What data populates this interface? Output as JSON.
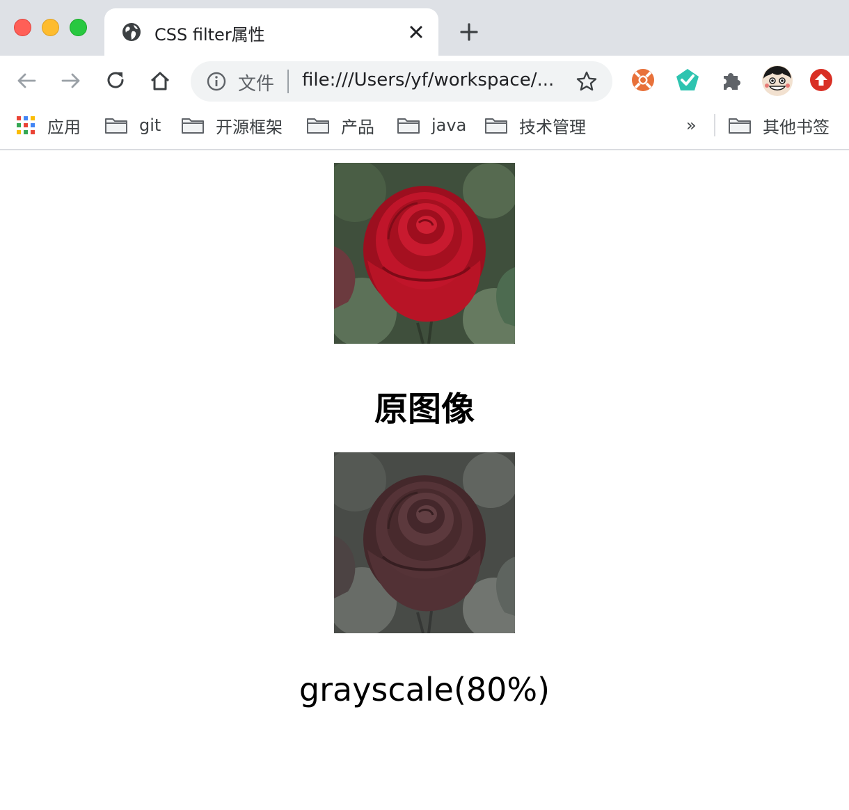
{
  "tab": {
    "title": "CSS filter属性",
    "close_icon": "close-icon",
    "favicon": "globe-icon"
  },
  "new_tab_icon": "plus-icon",
  "window_controls": {
    "close": "#ff5f57",
    "minimize": "#febc2e",
    "maximize": "#28c840"
  },
  "toolbar": {
    "back_icon": "arrow-left-icon",
    "forward_icon": "arrow-right-icon",
    "reload_icon": "reload-icon",
    "home_icon": "home-icon",
    "omnibox": {
      "info_icon": "info-icon",
      "chip_label": "文件",
      "url": "file:///Users/yf/workspace/...",
      "star_icon": "star-icon"
    },
    "extensions": [
      "lifebuoy-icon",
      "check-pentagon-icon",
      "puzzle-icon",
      "avatar",
      "upload-icon"
    ]
  },
  "bookmarks": {
    "items": [
      {
        "label": "应用",
        "icon": "apps-grid-icon"
      },
      {
        "label": "git",
        "icon": "folder-icon"
      },
      {
        "label": "开源框架",
        "icon": "folder-icon"
      },
      {
        "label": "产品",
        "icon": "folder-icon"
      },
      {
        "label": "java",
        "icon": "folder-icon"
      },
      {
        "label": "技术管理",
        "icon": "folder-icon"
      }
    ],
    "overflow_label": "»",
    "other_label": "其他书签"
  },
  "content": {
    "original_caption": "原图像",
    "filtered_caption": "grayscale(80%)",
    "filter_percent": 80
  },
  "colors": {
    "tab_strip": "#dee1e6",
    "omnibox": "#f1f3f4",
    "rose": "#c0152a"
  }
}
